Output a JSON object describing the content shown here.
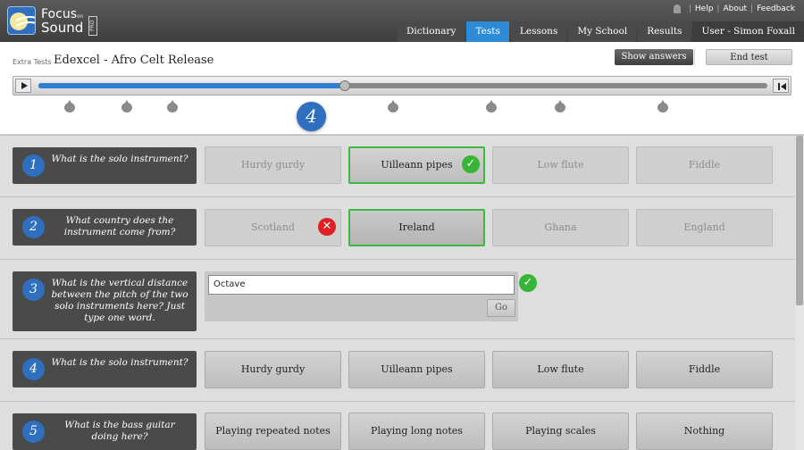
{
  "brand": {
    "line1": "Focus",
    "line2": "Sound",
    "on": "on",
    "pro": "PRO"
  },
  "top_links": {
    "help": "Help",
    "about": "About",
    "feedback": "Feedback"
  },
  "nav": {
    "tabs": [
      {
        "label": "Dictionary"
      },
      {
        "label": "Tests"
      },
      {
        "label": "Lessons"
      },
      {
        "label": "My School"
      },
      {
        "label": "Results"
      },
      {
        "label": "User - Simon Foxall"
      }
    ],
    "active_index": 1
  },
  "header": {
    "crumb": "Extra Tests",
    "title": "Edexcel - Afro Celt Release",
    "show_answers": "Show answers",
    "end_test": "End test"
  },
  "player": {
    "progress": 0.42,
    "active_marker": "4",
    "markers": [
      0.044,
      0.123,
      0.185,
      0.366,
      0.488,
      0.623,
      0.717,
      0.858
    ]
  },
  "questions": [
    {
      "num": "1",
      "text": "What is the solo instrument?",
      "options": [
        "Hurdy gurdy",
        "Uilleann pipes",
        "Low flute",
        "Fiddle"
      ]
    },
    {
      "num": "2",
      "text": "What country does the instrument come from?",
      "options": [
        "Scotland",
        "Ireland",
        "Ghana",
        "England"
      ]
    },
    {
      "num": "3",
      "text": "What is the vertical distance between the pitch of the two solo instruments here? Just type one word.",
      "answer_value": "Octave",
      "go_label": "Go"
    },
    {
      "num": "4",
      "text": "What is the solo instrument?",
      "options": [
        "Hurdy gurdy",
        "Uilleann pipes",
        "Low flute",
        "Fiddle"
      ]
    },
    {
      "num": "5",
      "text": "What is the bass guitar doing here?",
      "options": [
        "Playing repeated notes",
        "Playing long notes",
        "Playing scales",
        "Nothing"
      ]
    }
  ],
  "icons": {
    "correct": "check-icon",
    "wrong": "cross-icon"
  },
  "colors": {
    "accent": "#2f6fc0",
    "tab_active": "#2d8bd6",
    "correct": "#36b536",
    "wrong": "#e02020"
  }
}
